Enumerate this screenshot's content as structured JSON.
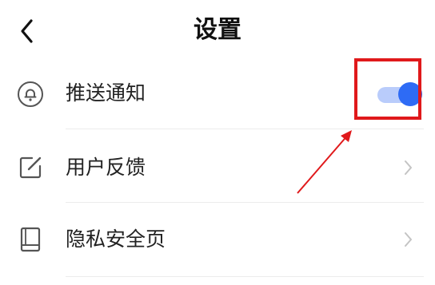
{
  "header": {
    "title": "设置",
    "back_icon": "chevron-left-icon"
  },
  "settings": [
    {
      "label": "推送通知",
      "icon": "bell-icon",
      "control": "toggle",
      "enabled": true
    },
    {
      "label": "用户反馈",
      "icon": "edit-icon",
      "control": "chevron"
    },
    {
      "label": "隐私安全页",
      "icon": "book-icon",
      "control": "chevron"
    }
  ],
  "colors": {
    "toggle_on_knob": "#2e6bf5",
    "toggle_on_track": "#b9ccfb",
    "annotation_red": "#e0191b",
    "icon_gray": "#555555",
    "chevron_gray": "#c4c4c4"
  }
}
